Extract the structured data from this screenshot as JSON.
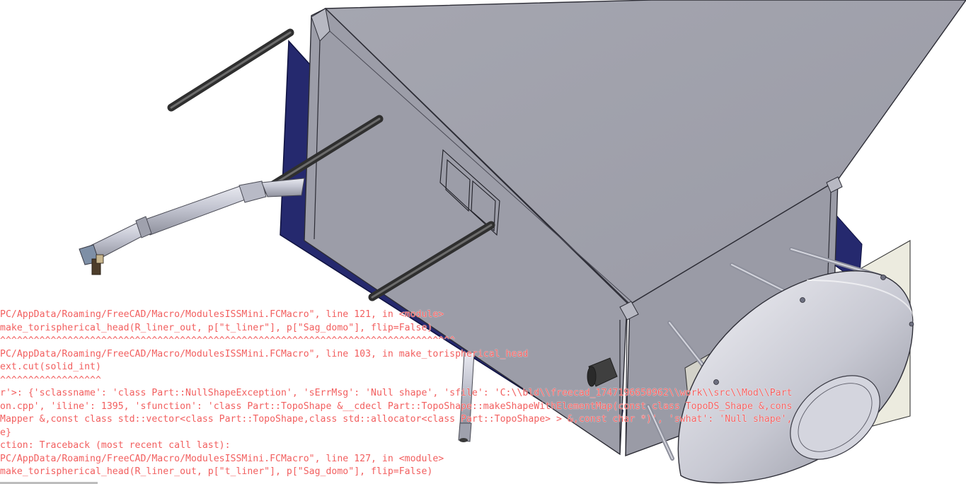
{
  "viewport": {
    "background": "#ffffff",
    "scene_colors": {
      "module_gray": "#9b9ca7",
      "module_top": "#a7a8b2",
      "panel_blue": "#22266e",
      "rod_dark": "#3c3c3c",
      "pipe_light": "#c9cbd6",
      "dome_shade": "#b5b7c3"
    }
  },
  "report": {
    "error_color": "#f25f5f",
    "lines": [
      "PC/AppData/Roaming/FreeCAD/Macro/ModulesISSMini.FCMacro\", line 121, in <module>",
      "make_torispherical_head(R_liner_out, p[\"t_liner\"], p[\"Sag_domo\"], flip=False)",
      "^^^^^^^^^^^^^^^^^^^^^^^^^^^^^^^^^^^^^^^^^^^^^^^^^^^^^^^^^^^^^^^^^^^^^^^^^^^^^^^^^",
      "PC/AppData/Roaming/FreeCAD/Macro/ModulesISSMini.FCMacro\", line 103, in make_torispherical_head",
      "ext.cut(solid_int)",
      "^^^^^^^^^^^^^^^^^^",
      "r'>: {'sclassname': 'class Part::NullShapeException', 'sErrMsg': 'Null shape', 'sfile': 'C:\\\\bld\\\\freecad_1747196650962\\\\work\\\\src\\\\Mod\\\\Part",
      "on.cpp', 'iline': 1395, 'sfunction': 'class Part::TopoShape &__cdecl Part::TopoShape::makeShapeWithElementMap(const class TopoDS_Shape &,cons",
      "Mapper &,const class std::vector<class Part::TopoShape,class std::allocator<class Part::TopoShape> > &,const char *)', 'swhat': 'Null shape',",
      "e}",
      "ction: Traceback (most recent call last):",
      "PC/AppData/Roaming/FreeCAD/Macro/ModulesISSMini.FCMacro\", line 127, in <module>",
      "make_torispherical_head(R_liner_out, p[\"t_liner\"], p[\"Sag_domo\"], flip=False)"
    ]
  }
}
